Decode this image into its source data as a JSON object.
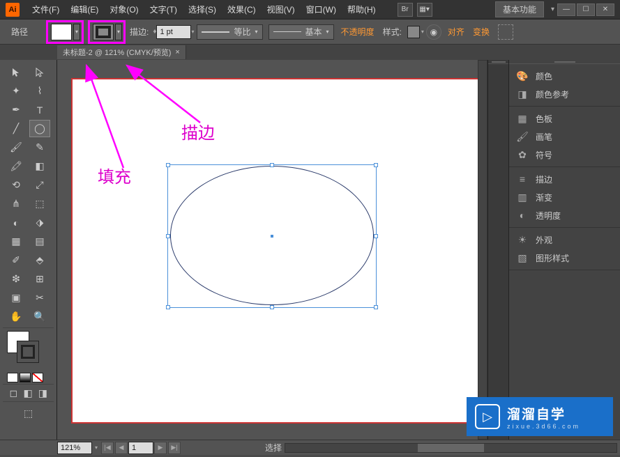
{
  "app": {
    "logo": "Ai",
    "workspace": "基本功能"
  },
  "menu": {
    "file": "文件(F)",
    "edit": "编辑(E)",
    "object": "对象(O)",
    "type": "文字(T)",
    "select": "选择(S)",
    "effect": "效果(C)",
    "view": "视图(V)",
    "window": "窗口(W)",
    "help": "帮助(H)"
  },
  "options": {
    "path_label": "路径",
    "stroke_label": "描边:",
    "stroke_weight": "1 pt",
    "profile_label": "等比",
    "brush_label": "基本",
    "opacity_label": "不透明度",
    "style_label": "样式:",
    "align_label": "对齐",
    "transform_label": "变换"
  },
  "document": {
    "tab_title": "未标题-2 @ 121% (CMYK/预览)"
  },
  "annotations": {
    "fill": "填充",
    "stroke": "描边"
  },
  "panels": {
    "color": "颜色",
    "color_guide": "颜色参考",
    "swatches": "色板",
    "brushes": "画笔",
    "symbols": "符号",
    "stroke": "描边",
    "gradient": "渐变",
    "transparency": "透明度",
    "appearance": "外观",
    "graphic_styles": "图形样式"
  },
  "status": {
    "zoom": "121%",
    "page": "1",
    "tool": "选择"
  },
  "watermark": {
    "title": "溜溜自学",
    "sub": "zixue.3d66.com"
  }
}
